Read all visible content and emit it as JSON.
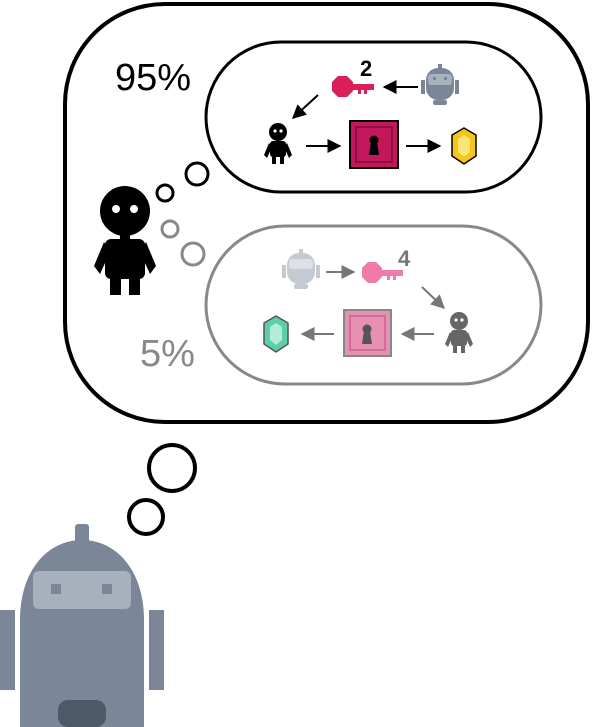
{
  "scenario_high": {
    "probability_label": "95%",
    "key_number": "2",
    "key_color": "#d81f59",
    "box_color": "#c2185b",
    "gem_color": "#f5c518"
  },
  "scenario_low": {
    "probability_label": "5%",
    "key_number": "4",
    "key_color": "#f07aa8",
    "box_color": "#e890b3",
    "gem_color": "#5ccfa8"
  },
  "colors": {
    "robot": "#7b8798",
    "robot_light": "#a7b0bd",
    "robot_faded": "#c4cad2",
    "agent": "#000000",
    "agent_faded": "#666666",
    "outline_high": "#000000",
    "outline_low": "#888888"
  },
  "icons": [
    "robot-icon",
    "agent-figure-icon",
    "key-icon",
    "locked-box-icon",
    "gem-icon",
    "arrow-icon"
  ]
}
